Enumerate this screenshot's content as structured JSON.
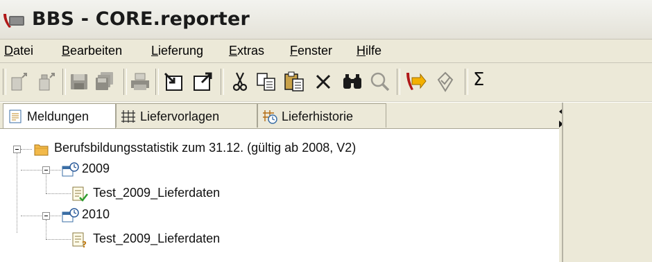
{
  "window": {
    "title": "BBS - CORE.reporter"
  },
  "menu": {
    "items": [
      {
        "mnemonic": "D",
        "rest": "atei"
      },
      {
        "mnemonic": "B",
        "rest": "earbeiten"
      },
      {
        "mnemonic": "L",
        "rest": "ieferung"
      },
      {
        "mnemonic": "E",
        "rest": "xtras"
      },
      {
        "mnemonic": "F",
        "rest": "enster"
      },
      {
        "mnemonic": "H",
        "rest": "ilfe"
      }
    ]
  },
  "toolbar": {
    "icons": [
      "new-doc-icon",
      "edit-doc-icon",
      "save-icon",
      "save-all-icon",
      "print-icon",
      "import-icon",
      "export-icon",
      "cut-icon",
      "copy-icon",
      "paste-icon",
      "delete-icon",
      "find-icon",
      "zoom-icon",
      "send-icon",
      "validate-icon",
      "sum-icon"
    ],
    "sum_symbol": "Σ"
  },
  "tabs": [
    {
      "label": "Meldungen",
      "icon": "report-icon",
      "active": true
    },
    {
      "label": "Liefervorlagen",
      "icon": "grid-icon",
      "active": false
    },
    {
      "label": "Lieferhistorie",
      "icon": "history-icon",
      "active": false
    }
  ],
  "tree": {
    "root": {
      "label": "Berufsbildungsstatistik zum 31.12. (gültig ab 2008, V2)",
      "icon": "folder-icon"
    },
    "years": [
      {
        "label": "2009",
        "icon": "calendar-icon",
        "child": {
          "label": "Test_2009_Lieferdaten",
          "status": "valid",
          "icon": "doc-check-icon"
        }
      },
      {
        "label": "2010",
        "icon": "calendar-icon",
        "child": {
          "label": "Test_2009_Lieferdaten",
          "status": "unknown",
          "icon": "doc-question-icon"
        }
      }
    ]
  },
  "colors": {
    "chrome": "#ece9d8",
    "folder": "#f2b94a",
    "check": "#2e9e2e",
    "question": "#c07a10"
  }
}
